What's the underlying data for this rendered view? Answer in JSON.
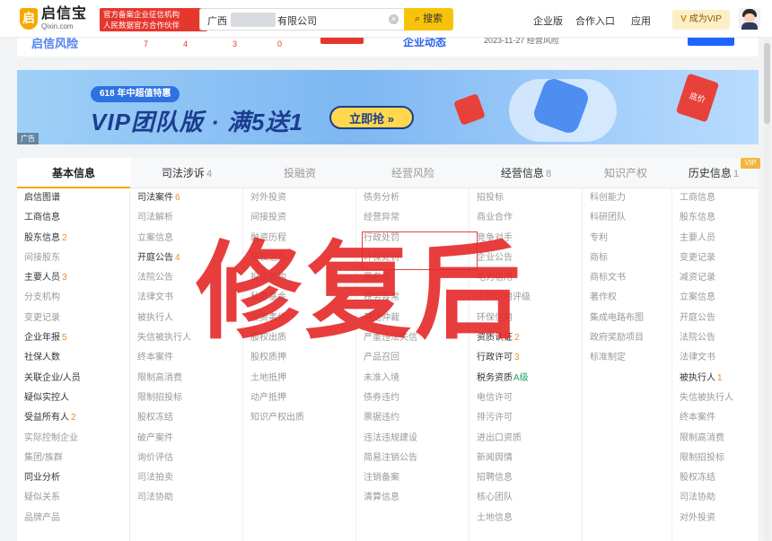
{
  "header": {
    "logo_name": "启信宝",
    "logo_domain": "Qixin.com",
    "badge_line1": "官方备案企业征信机构",
    "badge_line2": "人民数据官方合作伙伴",
    "search_value_prefix": "广西",
    "search_value_suffix": "有限公司",
    "search_button": "搜索",
    "nav": [
      "企业版",
      "合作入口",
      "应用"
    ],
    "vip_label": "成为VIP"
  },
  "strip": {
    "left_text": "启信风险",
    "numbers": [
      "7",
      "4",
      "3",
      "0"
    ],
    "right_text": "企业动态",
    "date_text": "2023-11-27 经营风险"
  },
  "banner": {
    "tag": "618  年中超值特惠",
    "title": "VIP团队版 · 满5送1",
    "button": "立即抢 »",
    "ad": "广告",
    "price_tag": "底价"
  },
  "tabs": [
    {
      "label": "基本信息",
      "count": ""
    },
    {
      "label": "司法涉诉",
      "count": "4"
    },
    {
      "label": "投融资",
      "count": ""
    },
    {
      "label": "经营风险",
      "count": ""
    },
    {
      "label": "经营信息",
      "count": "8"
    },
    {
      "label": "知识产权",
      "count": ""
    },
    {
      "label": "历史信息",
      "count": "1"
    }
  ],
  "vip_tag": "VIP",
  "columns": [
    [
      {
        "t": "启信图谱",
        "s": "dark"
      },
      {
        "t": "工商信息",
        "s": "dark"
      },
      {
        "t": "股东信息",
        "s": "dark",
        "n": "2"
      },
      {
        "t": "间接股东",
        "s": "gray"
      },
      {
        "t": "主要人员",
        "s": "dark",
        "n": "3"
      },
      {
        "t": "分支机构",
        "s": "gray"
      },
      {
        "t": "变更记录",
        "s": "gray"
      },
      {
        "t": "企业年报",
        "s": "dark",
        "n": "5"
      },
      {
        "t": "社保人数",
        "s": "dark"
      },
      {
        "t": "关联企业/人员",
        "s": "dark"
      },
      {
        "t": "疑似实控人",
        "s": "dark"
      },
      {
        "t": "受益所有人",
        "s": "dark",
        "n": "2"
      },
      {
        "t": "实际控制企业",
        "s": "gray"
      },
      {
        "t": "集团/族群",
        "s": "gray"
      },
      {
        "t": "同业分析",
        "s": "dark"
      },
      {
        "t": "疑似关系",
        "s": "gray"
      },
      {
        "t": "品牌产品",
        "s": "gray"
      }
    ],
    [
      {
        "t": "司法案件",
        "s": "dark",
        "n": "6"
      },
      {
        "t": "司法解析",
        "s": "gray"
      },
      {
        "t": "立案信息",
        "s": "gray"
      },
      {
        "t": "开庭公告",
        "s": "dark",
        "n": "4"
      },
      {
        "t": "法院公告",
        "s": "gray"
      },
      {
        "t": "法律文书",
        "s": "gray"
      },
      {
        "t": "被执行人",
        "s": "gray"
      },
      {
        "t": "失信被执行人",
        "s": "gray"
      },
      {
        "t": "终本案件",
        "s": "gray"
      },
      {
        "t": "限制高消费",
        "s": "gray"
      },
      {
        "t": "限制招投标",
        "s": "gray"
      },
      {
        "t": "股权冻结",
        "s": "gray"
      },
      {
        "t": "破产案件",
        "s": "gray"
      },
      {
        "t": "询价评估",
        "s": "gray"
      },
      {
        "t": "司法拍卖",
        "s": "gray"
      },
      {
        "t": "司法协助",
        "s": "gray"
      }
    ],
    [
      {
        "t": "对外投资",
        "s": "gray"
      },
      {
        "t": "间接投资",
        "s": "gray"
      },
      {
        "t": "融资历程",
        "s": "gray"
      },
      {
        "t": "债权信息",
        "s": "gray"
      },
      {
        "t": "投资机构",
        "s": "gray"
      },
      {
        "t": "私募基金",
        "s": "gray"
      },
      {
        "t": "投资事件",
        "s": "gray"
      },
      {
        "t": "股权出质",
        "s": "gray"
      },
      {
        "t": "股权质押",
        "s": "gray"
      },
      {
        "t": "土地抵押",
        "s": "gray"
      },
      {
        "t": "动产抵押",
        "s": "gray"
      },
      {
        "t": "知识产权出质",
        "s": "gray"
      }
    ],
    [
      {
        "t": "债务分析",
        "s": "gray"
      },
      {
        "t": "经营异常",
        "s": "gray"
      },
      {
        "t": "行政处罚",
        "s": "gray"
      },
      {
        "t": "环保处罚",
        "s": "gray"
      },
      {
        "t": "黑名单",
        "s": "gray"
      },
      {
        "t": "税务异常",
        "s": "gray"
      },
      {
        "t": "劳动仲裁",
        "s": "gray"
      },
      {
        "t": "严重违法失信",
        "s": "gray"
      },
      {
        "t": "产品召回",
        "s": "gray"
      },
      {
        "t": "未准入境",
        "s": "gray"
      },
      {
        "t": "债券违约",
        "s": "gray"
      },
      {
        "t": "票据违约",
        "s": "gray"
      },
      {
        "t": "违法违规建设",
        "s": "gray"
      },
      {
        "t": "简易注销公告",
        "s": "gray"
      },
      {
        "t": "注销备案",
        "s": "gray"
      },
      {
        "t": "清算信息",
        "s": "gray"
      }
    ],
    [
      {
        "t": "招投标",
        "s": "gray"
      },
      {
        "t": "商业合作",
        "s": "gray"
      },
      {
        "t": "竞争对手",
        "s": "gray"
      },
      {
        "t": "企业公告",
        "s": "gray"
      },
      {
        "t": "电力信用",
        "s": "gray"
      },
      {
        "t": "主体信用评级",
        "s": "gray"
      },
      {
        "t": "环保信用",
        "s": "gray"
      },
      {
        "t": "资质认证",
        "s": "dark",
        "n": "2"
      },
      {
        "t": "行政许可",
        "s": "dark",
        "n": "3"
      },
      {
        "t": "税务资质",
        "s": "dark",
        "lv": "A级"
      },
      {
        "t": "电信许可",
        "s": "gray"
      },
      {
        "t": "排污许可",
        "s": "gray"
      },
      {
        "t": "进出口资质",
        "s": "gray"
      },
      {
        "t": "新闻舆情",
        "s": "gray"
      },
      {
        "t": "招聘信息",
        "s": "gray"
      },
      {
        "t": "核心团队",
        "s": "gray"
      },
      {
        "t": "土地信息",
        "s": "gray"
      }
    ],
    [
      {
        "t": "科创能力",
        "s": "gray"
      },
      {
        "t": "科研团队",
        "s": "gray"
      },
      {
        "t": "专利",
        "s": "gray"
      },
      {
        "t": "商标",
        "s": "gray"
      },
      {
        "t": "商标文书",
        "s": "gray"
      },
      {
        "t": "著作权",
        "s": "gray"
      },
      {
        "t": "集成电路布图",
        "s": "gray"
      },
      {
        "t": "政府奖励项目",
        "s": "gray"
      },
      {
        "t": "标准制定",
        "s": "gray"
      }
    ],
    [
      {
        "t": "工商信息",
        "s": "gray"
      },
      {
        "t": "股东信息",
        "s": "gray"
      },
      {
        "t": "主要人员",
        "s": "gray"
      },
      {
        "t": "变更记录",
        "s": "gray"
      },
      {
        "t": "减资记录",
        "s": "gray"
      },
      {
        "t": "立案信息",
        "s": "gray"
      },
      {
        "t": "开庭公告",
        "s": "gray"
      },
      {
        "t": "法院公告",
        "s": "gray"
      },
      {
        "t": "法律文书",
        "s": "gray"
      },
      {
        "t": "被执行人",
        "s": "dark",
        "n": "1"
      },
      {
        "t": "失信被执行人",
        "s": "gray"
      },
      {
        "t": "终本案件",
        "s": "gray"
      },
      {
        "t": "限制高消费",
        "s": "gray"
      },
      {
        "t": "限制招投标",
        "s": "gray"
      },
      {
        "t": "股权冻结",
        "s": "gray"
      },
      {
        "t": "司法协助",
        "s": "gray"
      },
      {
        "t": "对外投资",
        "s": "gray"
      }
    ]
  ],
  "watermark": "修复后",
  "colors": {
    "accent": "#f5a800",
    "brand_red": "#e6372e",
    "count_orange": "#f08a24"
  }
}
